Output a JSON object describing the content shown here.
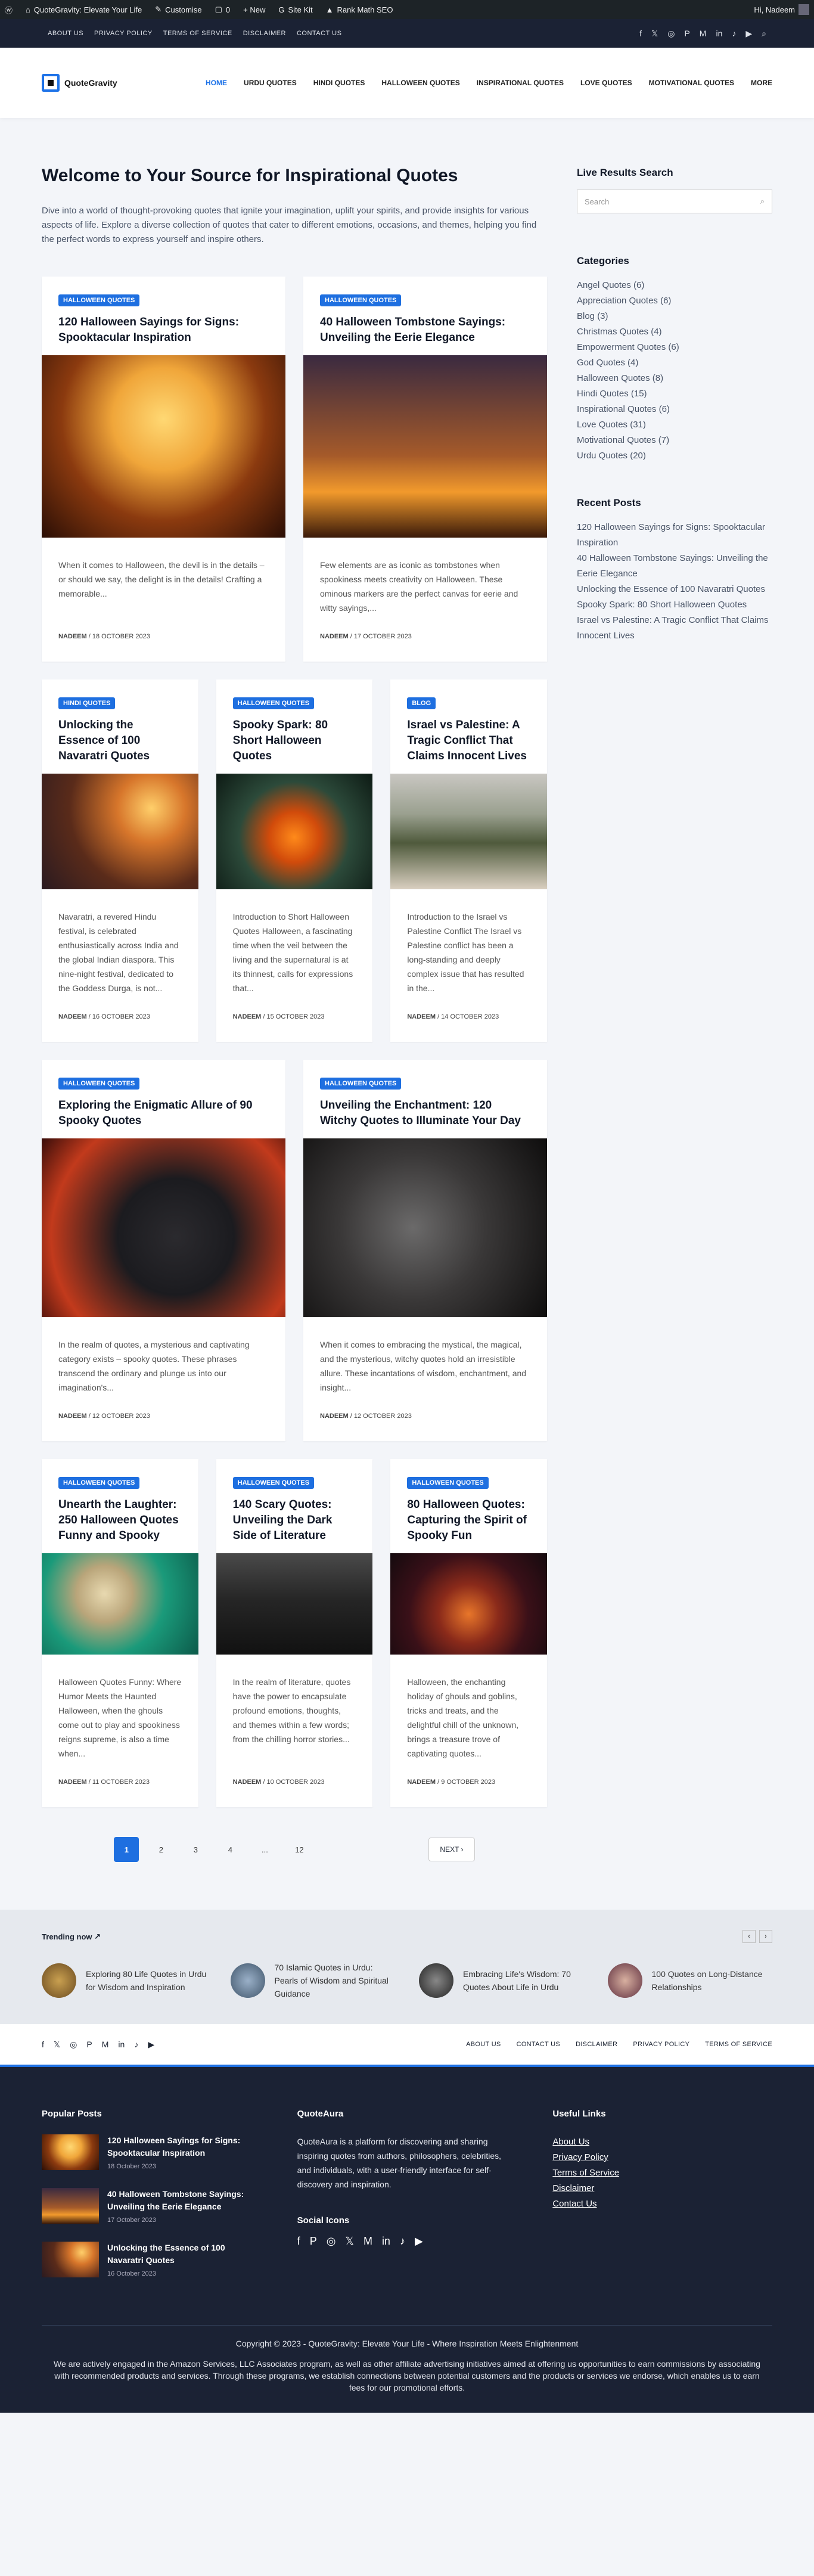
{
  "adminbar": {
    "site": "QuoteGravity: Elevate Your Life",
    "customise": "Customise",
    "comments": "0",
    "new": "+ New",
    "sitekit": "Site Kit",
    "rankmath": "Rank Math SEO",
    "user": "Hi, Nadeem"
  },
  "topbar": {
    "links": [
      "ABOUT US",
      "PRIVACY POLICY",
      "TERMS OF SERVICE",
      "DISCLAIMER",
      "CONTACT US"
    ]
  },
  "logo": "QuoteGravity",
  "nav": [
    "HOME",
    "URDU QUOTES",
    "HINDI QUOTES",
    "HALLOWEEN QUOTES",
    "INSPIRATIONAL QUOTES",
    "LOVE QUOTES",
    "MOTIVATIONAL QUOTES",
    "MORE"
  ],
  "welcome": "Welcome to Your Source for Inspirational Quotes",
  "intro": "Dive into a world of thought-provoking quotes that ignite your imagination, uplift your spirits, and provide insights for various aspects of life. Explore a diverse collection of quotes that cater to different emotions, occasions, and themes, helping you find the perfect words to express yourself and inspire others.",
  "posts": [
    {
      "tag": "HALLOWEEN QUOTES",
      "title": "120 Halloween Sayings for Signs: Spooktacular Inspiration",
      "excerpt": "When it comes to Halloween, the devil is in the details – or should we say, the delight is in the details! Crafting a memorable...",
      "author": "NADEEM",
      "date": "18 OCTOBER 2023"
    },
    {
      "tag": "HALLOWEEN QUOTES",
      "title": "40 Halloween Tombstone Sayings: Unveiling the Eerie Elegance",
      "excerpt": "Few elements are as iconic as tombstones when spookiness meets creativity on Halloween. These ominous markers are the perfect canvas for eerie and witty sayings,...",
      "author": "NADEEM",
      "date": "17 OCTOBER 2023"
    },
    {
      "tag": "HINDI QUOTES",
      "title": "Unlocking the Essence of 100 Navaratri Quotes",
      "excerpt": "Navaratri, a revered Hindu festival, is celebrated enthusiastically across India and the global Indian diaspora. This nine-night festival, dedicated to the Goddess Durga, is not...",
      "author": "NADEEM",
      "date": "16 OCTOBER 2023"
    },
    {
      "tag": "HALLOWEEN QUOTES",
      "title": "Spooky Spark: 80 Short Halloween Quotes",
      "excerpt": "Introduction to Short Halloween Quotes Halloween, a fascinating time when the veil between the living and the supernatural is at its thinnest, calls for expressions that...",
      "author": "NADEEM",
      "date": "15 OCTOBER 2023"
    },
    {
      "tag": "BLOG",
      "title": "Israel vs Palestine: A Tragic Conflict That Claims Innocent Lives",
      "excerpt": "Introduction to the Israel vs Palestine Conflict The Israel vs Palestine conflict has been a long-standing and deeply complex issue that has resulted in the...",
      "author": "NADEEM",
      "date": "14 OCTOBER 2023"
    },
    {
      "tag": "HALLOWEEN QUOTES",
      "title": "Exploring the Enigmatic Allure of 90 Spooky Quotes",
      "excerpt": "In the realm of quotes, a mysterious and captivating category exists – spooky quotes. These phrases transcend the ordinary and plunge us into our imagination's...",
      "author": "NADEEM",
      "date": "12 OCTOBER 2023"
    },
    {
      "tag": "HALLOWEEN QUOTES",
      "title": "Unveiling the Enchantment: 120 Witchy Quotes to Illuminate Your Day",
      "excerpt": "When it comes to embracing the mystical, the magical, and the mysterious, witchy quotes hold an irresistible allure. These incantations of wisdom, enchantment, and insight...",
      "author": "NADEEM",
      "date": "12 OCTOBER 2023"
    },
    {
      "tag": "HALLOWEEN QUOTES",
      "title": "Unearth the Laughter: 250 Halloween Quotes Funny and Spooky",
      "excerpt": "Halloween Quotes Funny: Where Humor Meets the Haunted Halloween, when the ghouls come out to play and spookiness reigns supreme, is also a time when...",
      "author": "NADEEM",
      "date": "11 OCTOBER 2023"
    },
    {
      "tag": "HALLOWEEN QUOTES",
      "title": "140 Scary Quotes: Unveiling the Dark Side of Literature",
      "excerpt": "In the realm of literature, quotes have the power to encapsulate profound emotions, thoughts, and themes within a few words; from the chilling horror stories...",
      "author": "NADEEM",
      "date": "10 OCTOBER 2023"
    },
    {
      "tag": "HALLOWEEN QUOTES",
      "title": "80 Halloween Quotes: Capturing the Spirit of Spooky Fun",
      "excerpt": "Halloween, the enchanting holiday of ghouls and goblins, tricks and treats, and the delightful chill of the unknown, brings a treasure trove of captivating quotes...",
      "author": "NADEEM",
      "date": "9 OCTOBER 2023"
    }
  ],
  "pagination": {
    "pages": [
      "1",
      "2",
      "3",
      "4",
      "...",
      "12"
    ],
    "next": "NEXT"
  },
  "sidebar": {
    "search_title": "Live Results Search",
    "search_placeholder": "Search",
    "cat_title": "Categories",
    "categories": [
      "Angel Quotes (6)",
      "Appreciation Quotes (6)",
      "Blog (3)",
      "Christmas Quotes (4)",
      "Empowerment Quotes (6)",
      "God Quotes (4)",
      "Halloween Quotes (8)",
      "Hindi Quotes (15)",
      "Inspirational Quotes (6)",
      "Love Quotes (31)",
      "Motivational Quotes (7)",
      "Urdu Quotes (20)"
    ],
    "recent_title": "Recent Posts",
    "recent": [
      "120 Halloween Sayings for Signs: Spooktacular Inspiration",
      "40 Halloween Tombstone Sayings: Unveiling the Eerie Elegance",
      "Unlocking the Essence of 100 Navaratri Quotes",
      "Spooky Spark: 80 Short Halloween Quotes",
      "Israel vs Palestine: A Tragic Conflict That Claims Innocent Lives"
    ]
  },
  "trending": {
    "title": "Trending now",
    "items": [
      "Exploring 80 Life Quotes in Urdu for Wisdom and Inspiration",
      "70 Islamic Quotes in Urdu: Pearls of Wisdom and Spiritual Guidance",
      "Embracing Life's Wisdom: 70 Quotes About Life in Urdu",
      "100 Quotes on Long-Distance Relationships"
    ]
  },
  "footer_links": [
    "ABOUT US",
    "CONTACT US",
    "DISCLAIMER",
    "PRIVACY POLICY",
    "TERMS OF SERVICE"
  ],
  "footer": {
    "popular_title": "Popular Posts",
    "popular": [
      {
        "title": "120 Halloween Sayings for Signs: Spooktacular Inspiration",
        "date": "18 October 2023"
      },
      {
        "title": "40 Halloween Tombstone Sayings: Unveiling the Eerie Elegance",
        "date": "17 October 2023"
      },
      {
        "title": "Unlocking the Essence of 100 Navaratri Quotes",
        "date": "16 October 2023"
      }
    ],
    "about_title": "QuoteAura",
    "about": "QuoteAura is a platform for discovering and sharing inspiring quotes from authors, philosophers, celebrities, and individuals, with a user-friendly interface for self-discovery and inspiration.",
    "social_title": "Social Icons",
    "useful_title": "Useful Links",
    "useful": [
      "About Us",
      "Privacy Policy",
      "Terms of Service",
      "Disclaimer",
      "Contact Us"
    ],
    "copyright": "Copyright © 2023 - QuoteGravity: Elevate Your Life - Where Inspiration Meets Enlightenment",
    "amazon": "We are actively engaged in the Amazon Services, LLC Associates program, as well as other affiliate advertising initiatives aimed at offering us opportunities to earn commissions by associating with recommended products and services. Through these programs, we establish connections between potential customers and the products or services we endorse, which enables us to earn fees for our promotional efforts."
  }
}
